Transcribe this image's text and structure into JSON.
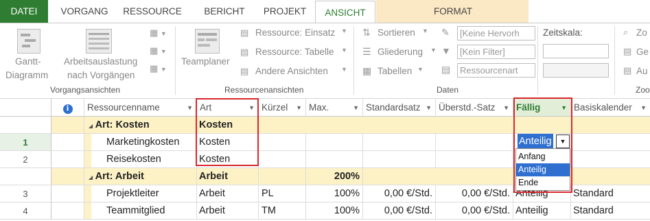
{
  "tabs": {
    "file": "DATEI",
    "vorgang": "VORGANG",
    "ressource": "RESSOURCE",
    "bericht": "BERICHT",
    "projekt": "PROJEKT",
    "ansicht": "ANSICHT",
    "format": "FORMAT"
  },
  "ribbon": {
    "vorgangsansichten": {
      "label": "Vorgangsansichten",
      "gantt_line1": "Gantt-",
      "gantt_line2": "Diagramm",
      "auslastung_line1": "Arbeitsauslastung",
      "auslastung_line2": "nach Vorgängen"
    },
    "ressourcenansichten": {
      "label": "Ressourcenansichten",
      "teamplaner": "Teamplaner",
      "einsatz": "Ressource: Einsatz",
      "tabelle": "Ressource: Tabelle",
      "andere": "Andere Ansichten"
    },
    "daten": {
      "label": "Daten",
      "sortieren": "Sortieren",
      "gliederung": "Gliederung",
      "tabellen": "Tabellen",
      "hervorhebung": "[Keine Hervorh",
      "filter": "[Kein Filter]",
      "gruppe": "Ressourcenart"
    },
    "zeitskala": {
      "label": "Zeitskala:",
      "zoom_label": "Zoo",
      "zoom1": "Zo",
      "zoom2": "Ge",
      "zoom3": "Au"
    }
  },
  "table": {
    "info_icon": "info-icon",
    "headers": {
      "name": "Ressourcenname",
      "art": "Art",
      "kuerzel": "Kürzel",
      "max": "Max.",
      "standardsatz": "Standardsatz",
      "ueberstd": "Überstd.-Satz",
      "faellig": "Fällig",
      "basiskalender": "Basiskalender"
    },
    "groups": [
      {
        "title": "Art: Kosten",
        "art": "Kosten",
        "max": ""
      },
      {
        "title": "Art: Arbeit",
        "art": "Arbeit",
        "max": "200%"
      }
    ],
    "rows": [
      {
        "num": "1",
        "name": "Marketingkosten",
        "art": "Kosten",
        "kuerzel": "",
        "max": "",
        "standardsatz": "",
        "ueberstd": "",
        "faellig": "Anteilig",
        "basiskalender": ""
      },
      {
        "num": "2",
        "name": "Reisekosten",
        "art": "Kosten",
        "kuerzel": "",
        "max": "",
        "standardsatz": "",
        "ueberstd": "",
        "faellig": "",
        "basiskalender": ""
      },
      {
        "num": "3",
        "name": "Projektleiter",
        "art": "Arbeit",
        "kuerzel": "PL",
        "max": "100%",
        "standardsatz": "0,00 €/Std.",
        "ueberstd": "0,00 €/Std.",
        "faellig": "Anteilig",
        "basiskalender": "Standard"
      },
      {
        "num": "4",
        "name": "Teammitglied",
        "art": "Arbeit",
        "kuerzel": "TM",
        "max": "100%",
        "standardsatz": "0,00 €/Std.",
        "ueberstd": "0,00 €/Std.",
        "faellig": "Anteilig",
        "basiskalender": "Standard"
      }
    ]
  },
  "dropdown": {
    "current": "Anteilig",
    "options": [
      "Anfang",
      "Anteilig",
      "Ende"
    ],
    "selected": "Anteilig"
  },
  "colors": {
    "accent": "#2e7d32",
    "group_row": "#fdf2c6",
    "highlight": "#d9262c",
    "selection": "#2f6fd0"
  }
}
